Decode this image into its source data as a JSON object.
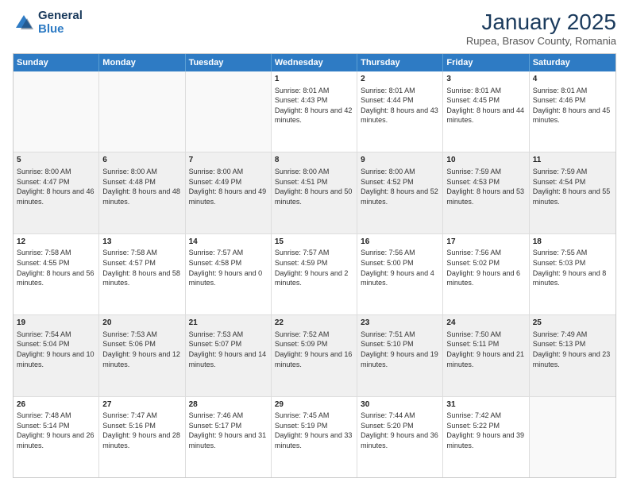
{
  "logo": {
    "general": "General",
    "blue": "Blue"
  },
  "header": {
    "month_year": "January 2025",
    "location": "Rupea, Brasov County, Romania"
  },
  "days_of_week": [
    "Sunday",
    "Monday",
    "Tuesday",
    "Wednesday",
    "Thursday",
    "Friday",
    "Saturday"
  ],
  "weeks": [
    [
      {
        "day": "",
        "sunrise": "",
        "sunset": "",
        "daylight": "",
        "empty": true
      },
      {
        "day": "",
        "sunrise": "",
        "sunset": "",
        "daylight": "",
        "empty": true
      },
      {
        "day": "",
        "sunrise": "",
        "sunset": "",
        "daylight": "",
        "empty": true
      },
      {
        "day": "1",
        "sunrise": "Sunrise: 8:01 AM",
        "sunset": "Sunset: 4:43 PM",
        "daylight": "Daylight: 8 hours and 42 minutes."
      },
      {
        "day": "2",
        "sunrise": "Sunrise: 8:01 AM",
        "sunset": "Sunset: 4:44 PM",
        "daylight": "Daylight: 8 hours and 43 minutes."
      },
      {
        "day": "3",
        "sunrise": "Sunrise: 8:01 AM",
        "sunset": "Sunset: 4:45 PM",
        "daylight": "Daylight: 8 hours and 44 minutes."
      },
      {
        "day": "4",
        "sunrise": "Sunrise: 8:01 AM",
        "sunset": "Sunset: 4:46 PM",
        "daylight": "Daylight: 8 hours and 45 minutes."
      }
    ],
    [
      {
        "day": "5",
        "sunrise": "Sunrise: 8:00 AM",
        "sunset": "Sunset: 4:47 PM",
        "daylight": "Daylight: 8 hours and 46 minutes."
      },
      {
        "day": "6",
        "sunrise": "Sunrise: 8:00 AM",
        "sunset": "Sunset: 4:48 PM",
        "daylight": "Daylight: 8 hours and 48 minutes."
      },
      {
        "day": "7",
        "sunrise": "Sunrise: 8:00 AM",
        "sunset": "Sunset: 4:49 PM",
        "daylight": "Daylight: 8 hours and 49 minutes."
      },
      {
        "day": "8",
        "sunrise": "Sunrise: 8:00 AM",
        "sunset": "Sunset: 4:51 PM",
        "daylight": "Daylight: 8 hours and 50 minutes."
      },
      {
        "day": "9",
        "sunrise": "Sunrise: 8:00 AM",
        "sunset": "Sunset: 4:52 PM",
        "daylight": "Daylight: 8 hours and 52 minutes."
      },
      {
        "day": "10",
        "sunrise": "Sunrise: 7:59 AM",
        "sunset": "Sunset: 4:53 PM",
        "daylight": "Daylight: 8 hours and 53 minutes."
      },
      {
        "day": "11",
        "sunrise": "Sunrise: 7:59 AM",
        "sunset": "Sunset: 4:54 PM",
        "daylight": "Daylight: 8 hours and 55 minutes."
      }
    ],
    [
      {
        "day": "12",
        "sunrise": "Sunrise: 7:58 AM",
        "sunset": "Sunset: 4:55 PM",
        "daylight": "Daylight: 8 hours and 56 minutes."
      },
      {
        "day": "13",
        "sunrise": "Sunrise: 7:58 AM",
        "sunset": "Sunset: 4:57 PM",
        "daylight": "Daylight: 8 hours and 58 minutes."
      },
      {
        "day": "14",
        "sunrise": "Sunrise: 7:57 AM",
        "sunset": "Sunset: 4:58 PM",
        "daylight": "Daylight: 9 hours and 0 minutes."
      },
      {
        "day": "15",
        "sunrise": "Sunrise: 7:57 AM",
        "sunset": "Sunset: 4:59 PM",
        "daylight": "Daylight: 9 hours and 2 minutes."
      },
      {
        "day": "16",
        "sunrise": "Sunrise: 7:56 AM",
        "sunset": "Sunset: 5:00 PM",
        "daylight": "Daylight: 9 hours and 4 minutes."
      },
      {
        "day": "17",
        "sunrise": "Sunrise: 7:56 AM",
        "sunset": "Sunset: 5:02 PM",
        "daylight": "Daylight: 9 hours and 6 minutes."
      },
      {
        "day": "18",
        "sunrise": "Sunrise: 7:55 AM",
        "sunset": "Sunset: 5:03 PM",
        "daylight": "Daylight: 9 hours and 8 minutes."
      }
    ],
    [
      {
        "day": "19",
        "sunrise": "Sunrise: 7:54 AM",
        "sunset": "Sunset: 5:04 PM",
        "daylight": "Daylight: 9 hours and 10 minutes."
      },
      {
        "day": "20",
        "sunrise": "Sunrise: 7:53 AM",
        "sunset": "Sunset: 5:06 PM",
        "daylight": "Daylight: 9 hours and 12 minutes."
      },
      {
        "day": "21",
        "sunrise": "Sunrise: 7:53 AM",
        "sunset": "Sunset: 5:07 PM",
        "daylight": "Daylight: 9 hours and 14 minutes."
      },
      {
        "day": "22",
        "sunrise": "Sunrise: 7:52 AM",
        "sunset": "Sunset: 5:09 PM",
        "daylight": "Daylight: 9 hours and 16 minutes."
      },
      {
        "day": "23",
        "sunrise": "Sunrise: 7:51 AM",
        "sunset": "Sunset: 5:10 PM",
        "daylight": "Daylight: 9 hours and 19 minutes."
      },
      {
        "day": "24",
        "sunrise": "Sunrise: 7:50 AM",
        "sunset": "Sunset: 5:11 PM",
        "daylight": "Daylight: 9 hours and 21 minutes."
      },
      {
        "day": "25",
        "sunrise": "Sunrise: 7:49 AM",
        "sunset": "Sunset: 5:13 PM",
        "daylight": "Daylight: 9 hours and 23 minutes."
      }
    ],
    [
      {
        "day": "26",
        "sunrise": "Sunrise: 7:48 AM",
        "sunset": "Sunset: 5:14 PM",
        "daylight": "Daylight: 9 hours and 26 minutes."
      },
      {
        "day": "27",
        "sunrise": "Sunrise: 7:47 AM",
        "sunset": "Sunset: 5:16 PM",
        "daylight": "Daylight: 9 hours and 28 minutes."
      },
      {
        "day": "28",
        "sunrise": "Sunrise: 7:46 AM",
        "sunset": "Sunset: 5:17 PM",
        "daylight": "Daylight: 9 hours and 31 minutes."
      },
      {
        "day": "29",
        "sunrise": "Sunrise: 7:45 AM",
        "sunset": "Sunset: 5:19 PM",
        "daylight": "Daylight: 9 hours and 33 minutes."
      },
      {
        "day": "30",
        "sunrise": "Sunrise: 7:44 AM",
        "sunset": "Sunset: 5:20 PM",
        "daylight": "Daylight: 9 hours and 36 minutes."
      },
      {
        "day": "31",
        "sunrise": "Sunrise: 7:42 AM",
        "sunset": "Sunset: 5:22 PM",
        "daylight": "Daylight: 9 hours and 39 minutes."
      },
      {
        "day": "",
        "sunrise": "",
        "sunset": "",
        "daylight": "",
        "empty": true
      }
    ]
  ]
}
